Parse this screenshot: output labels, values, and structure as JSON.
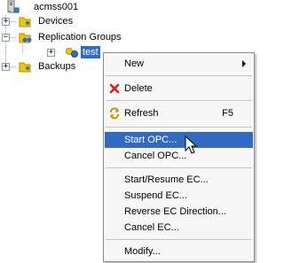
{
  "tree": {
    "root": {
      "label": "acmss001",
      "icon": "server-icon"
    },
    "devices": {
      "label": "Devices",
      "icon": "folder-icon"
    },
    "replication_groups": {
      "label": "Replication Groups",
      "icon": "folder-open-icon"
    },
    "test": {
      "label": "test",
      "icon": "replication-group-icon"
    },
    "backups": {
      "label": "Backups",
      "icon": "folder-icon"
    },
    "expander_symbols": {
      "collapsed": "+",
      "expanded": "−"
    }
  },
  "context_menu": {
    "new": {
      "label": "New"
    },
    "delete": {
      "label": "Delete",
      "icon": "red-x-icon"
    },
    "refresh": {
      "label": "Refresh",
      "shortcut": "F5",
      "icon": "refresh-icon"
    },
    "start_opc": {
      "label": "Start OPC..."
    },
    "cancel_opc": {
      "label": "Cancel OPC..."
    },
    "start_resume_ec": {
      "label": "Start/Resume EC..."
    },
    "suspend_ec": {
      "label": "Suspend EC..."
    },
    "reverse_ec": {
      "label": "Reverse EC Direction..."
    },
    "cancel_ec": {
      "label": "Cancel EC..."
    },
    "modify": {
      "label": "Modify..."
    }
  },
  "colors": {
    "selection": "#316ac5",
    "menu_bg": "#f7f7f7",
    "folder_yellow": "#f0c800",
    "delete_red": "#d92020"
  }
}
